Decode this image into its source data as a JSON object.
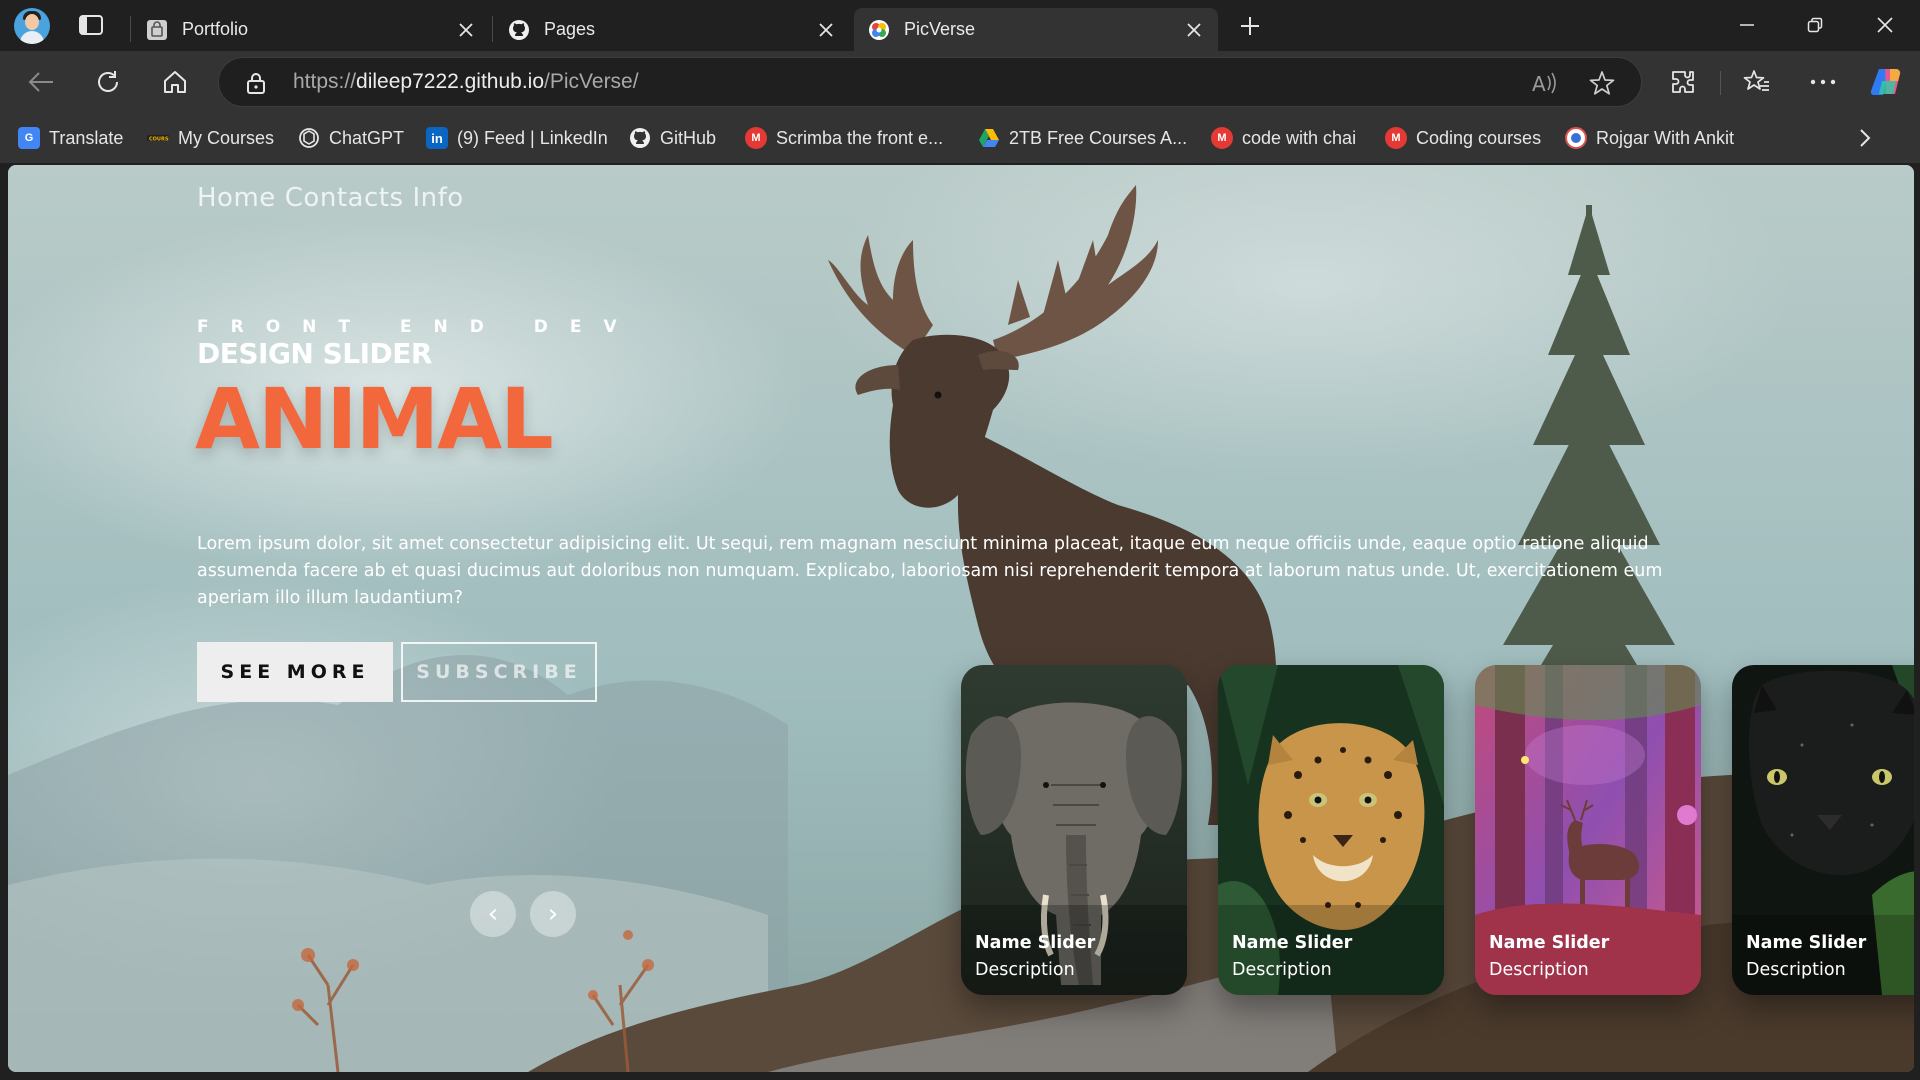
{
  "browser": {
    "tabs": [
      {
        "title": "Portfolio",
        "icon": "portfolio-favicon-icon",
        "active": false
      },
      {
        "title": "Pages",
        "icon": "github-icon",
        "active": false
      },
      {
        "title": "PicVerse",
        "icon": "picverse-favicon-icon",
        "active": true
      }
    ],
    "url": {
      "scheme": "https://",
      "host": "dileep7222.github.io",
      "path": "/PicVerse/"
    },
    "bookmarks": [
      {
        "label": "Translate",
        "icon": "google-translate-icon",
        "color": "#4285f4"
      },
      {
        "label": "My Courses",
        "icon": "courses-logo-icon",
        "color": "#d59b00"
      },
      {
        "label": "ChatGPT",
        "icon": "chatgpt-icon",
        "color": "#ffffff"
      },
      {
        "label": "(9) Feed | LinkedIn",
        "icon": "linkedin-icon",
        "color": "#0a66c2"
      },
      {
        "label": "GitHub",
        "icon": "github-icon",
        "color": "#ffffff"
      },
      {
        "label": "Scrimba the front e...",
        "icon": "gmail-m-icon",
        "color": "#e53935"
      },
      {
        "label": "2TB Free Courses A...",
        "icon": "google-drive-icon",
        "color": "#1fa463"
      },
      {
        "label": "code with chai",
        "icon": "gmail-m-icon",
        "color": "#e53935"
      },
      {
        "label": "Coding courses",
        "icon": "gmail-m-icon",
        "color": "#e53935"
      },
      {
        "label": "Rojgar With Ankit",
        "icon": "rojgar-logo-icon",
        "color": "#d9534f"
      }
    ]
  },
  "page": {
    "nav": [
      "Home",
      "Contacts",
      "Info"
    ],
    "kicker": "FRONT END DEV",
    "subtitle": "DESIGN SLIDER",
    "headline": "ANIMAL",
    "description": "Lorem ipsum dolor, sit amet consectetur adipisicing elit. Ut sequi, rem magnam nesciunt minima placeat, itaque eum neque officiis unde, eaque optio ratione aliquid assumenda facere ab et quasi ducimus aut doloribus non numquam. Explicabo, laboriosam nisi reprehenderit tempora at laborum natus unde. Ut, exercitationem eum aperiam illo illum laudantium?",
    "buttons": {
      "see_more": "SEE MORE",
      "subscribe": "SUBSCRIBE"
    },
    "accent": "#f2673b",
    "cards": [
      {
        "name": "Name Slider",
        "description": "Description",
        "subject": "elephant"
      },
      {
        "name": "Name Slider",
        "description": "Description",
        "subject": "leopard"
      },
      {
        "name": "Name Slider",
        "description": "Description",
        "subject": "deer in pink forest"
      },
      {
        "name": "Name Slider",
        "description": "Description",
        "subject": "black panther"
      }
    ],
    "arrows": {
      "prev": "‹",
      "next": "›"
    }
  }
}
